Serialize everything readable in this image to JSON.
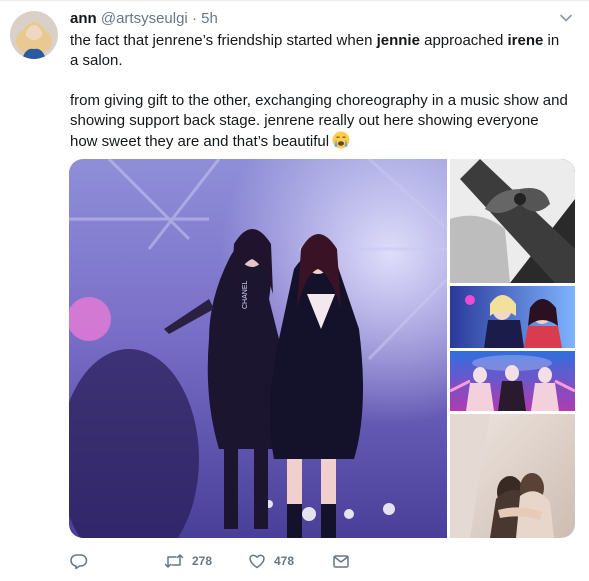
{
  "author": {
    "name": "ann",
    "handle": "@artsyseulgi",
    "separator": "·",
    "time": "5h"
  },
  "tweet": {
    "line1_a": "the fact that jenrene’s friendship started when ",
    "line1_b": "jennie",
    "line1_c": " approached ",
    "line1_d": "irene",
    "line1_e": " in a salon.",
    "line2": "from giving gift to the other, exchanging choreography in a music show and showing support back stage. jenrene really out here showing everyone how sweet they are and that’s beautiful",
    "emoji": "crying-face-emoji"
  },
  "media": {
    "photo_count": 5,
    "main_photo_label": "CHANEL"
  },
  "actions": {
    "reply_count": "",
    "retweet_count": "278",
    "like_count": "478"
  },
  "icons": [
    "caret-down-icon",
    "reply-icon",
    "retweet-icon",
    "heart-icon",
    "direct-message-icon"
  ],
  "colors": {
    "text": "#14171a",
    "secondary": "#657786",
    "border": "#e6ecf0"
  }
}
